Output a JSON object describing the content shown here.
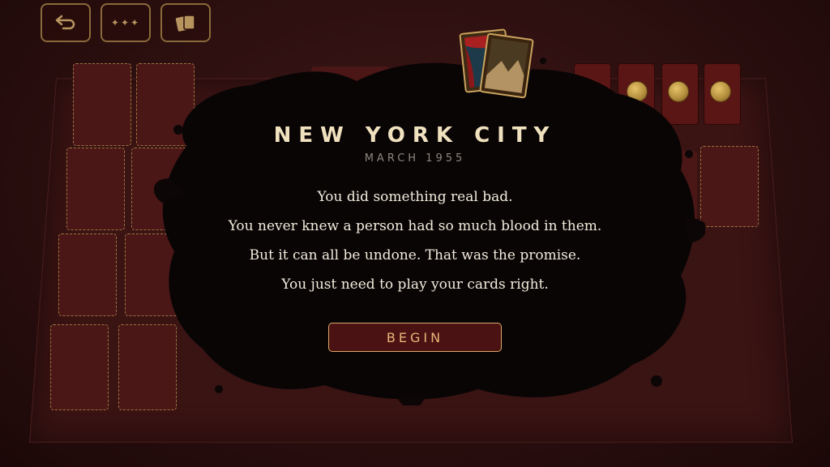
{
  "toolbar": {
    "undo_icon": "undo-arrow-icon",
    "menu_icon": "dots-icon",
    "menu_glyph": "✦✦✦",
    "cards_icon": "cards-icon"
  },
  "intro": {
    "title": "NEW YORK CITY",
    "subtitle": "MARCH 1955",
    "lines": [
      "You did something real bad.",
      "You never knew a person had so much blood in them.",
      "But it can all be undone. That was the promise.",
      "You just need to play your cards right."
    ],
    "begin_label": "BEGIN"
  },
  "colors": {
    "accent_gold": "#c9a25e",
    "board": "#3a1313",
    "button_text": "#eab57a"
  }
}
